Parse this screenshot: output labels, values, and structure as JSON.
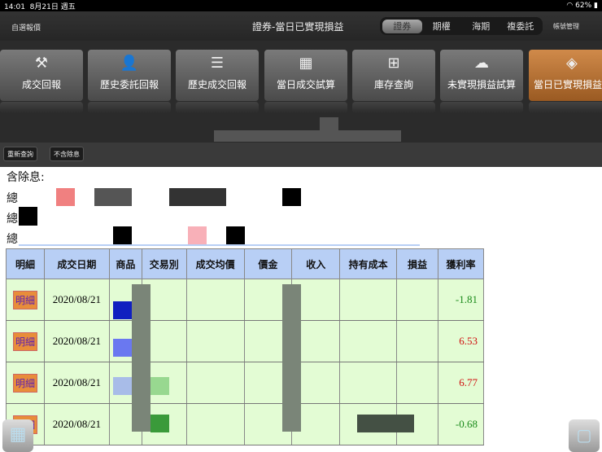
{
  "status_bar": {
    "time": "14:01",
    "date": "8月21日 週五",
    "battery": "62%"
  },
  "nav": {
    "left": "自選報價",
    "title": "證券-當日已實現損益",
    "segments": [
      "證券",
      "期權",
      "海期",
      "複委託"
    ],
    "account": "帳號管理"
  },
  "tiles": [
    {
      "label": "成交回報",
      "icon": "gavel-icon"
    },
    {
      "label": "歷史委託回報",
      "icon": "person-search-icon"
    },
    {
      "label": "歷史成交回報",
      "icon": "list-document-icon"
    },
    {
      "label": "當日成交試算",
      "icon": "grid-dollar-icon"
    },
    {
      "label": "庫存查詢",
      "icon": "grid-search-icon"
    },
    {
      "label": "未實現損益試算",
      "icon": "cloud-search-icon"
    },
    {
      "label": "當日已實現損益",
      "icon": "boxes-clock-icon"
    }
  ],
  "toolbar": {
    "requery": "重新查詢",
    "no_dividend": "不含除息"
  },
  "summary": {
    "heading": "含除息:",
    "row_labels": [
      "總",
      "總",
      "總"
    ]
  },
  "table": {
    "headers": [
      "明細",
      "成交日期",
      "商品",
      "交易別",
      "成交均價",
      "價金",
      "收入",
      "持有成本",
      "損益",
      "獲利率"
    ],
    "rows": [
      {
        "detail": "明細",
        "date": "2020/08/21",
        "rate": "-1.81",
        "rate_color": "#1a8a1a"
      },
      {
        "detail": "明細",
        "date": "2020/08/21",
        "rate": "6.53",
        "rate_color": "#d01010"
      },
      {
        "detail": "明細",
        "date": "2020/08/21",
        "rate": "6.77",
        "rate_color": "#d01010"
      },
      {
        "detail": "明細",
        "date": "2020/08/21",
        "rate": "-0.68",
        "rate_color": "#1a8a1a"
      }
    ]
  }
}
